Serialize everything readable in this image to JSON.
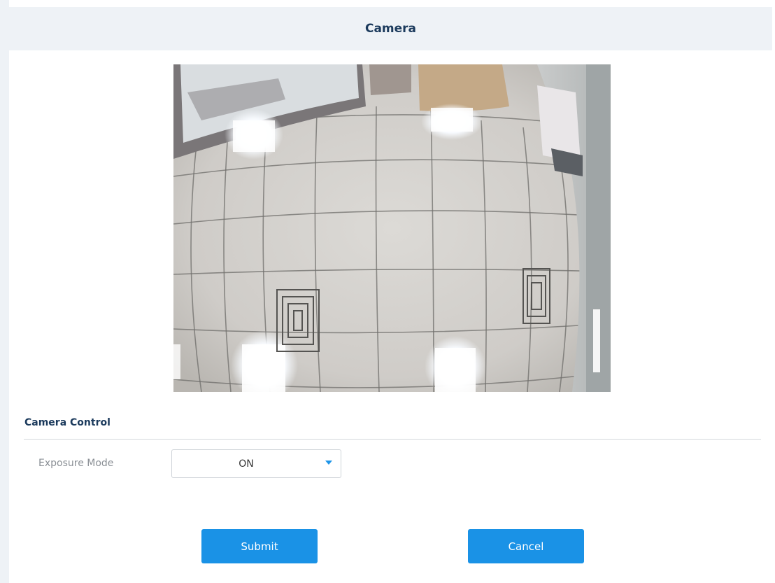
{
  "header": {
    "title": "Camera"
  },
  "camera_control": {
    "section_title": "Camera Control",
    "exposure_mode": {
      "label": "Exposure Mode",
      "value": "ON"
    }
  },
  "actions": {
    "submit_label": "Submit",
    "cancel_label": "Cancel"
  },
  "colors": {
    "accent": "#1a92e6",
    "header_bg": "#eef2f6",
    "title_text": "#1b3a5c"
  },
  "icons": {
    "dropdown": "caret-down-icon"
  }
}
